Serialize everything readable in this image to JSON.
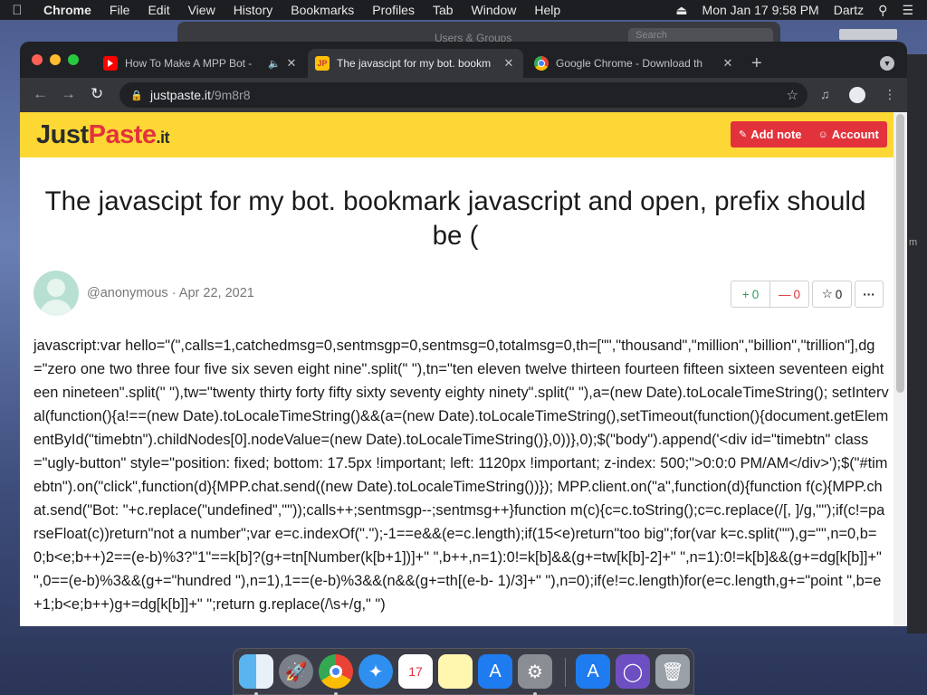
{
  "menubar": {
    "app": "Chrome",
    "menus": [
      "File",
      "Edit",
      "View",
      "History",
      "Bookmarks",
      "Profiles",
      "Tab",
      "Window",
      "Help"
    ],
    "clock": "Mon Jan 17  9:58 PM",
    "user": "Dartz"
  },
  "background_window": {
    "title": "Users & Groups",
    "search_placeholder": "Search",
    "edge_text": "m"
  },
  "tabs": [
    {
      "title": "How To Make A MPP Bot -",
      "favicon": "youtube-icon",
      "audio": true
    },
    {
      "title": "The javascipt for my bot. bookm",
      "favicon": "justpaste-icon",
      "active": true
    },
    {
      "title": "Google Chrome - Download th",
      "favicon": "chrome-icon"
    }
  ],
  "omnibox": {
    "host": "justpaste.it",
    "path": "/9m8r8"
  },
  "site": {
    "logo_part1": "Just",
    "logo_part2": "Paste",
    "logo_part3": ".it",
    "add_note": "Add note",
    "account": "Account",
    "brand_yellow": "#fdd835",
    "brand_red": "#e2333d"
  },
  "article": {
    "title": "The javascipt for my bot. bookmark javascript and open, prefix should be (",
    "author": "@anonymous",
    "separator": "·",
    "date": "Apr 22, 2021",
    "upvotes": "0",
    "downvotes": "0",
    "stars": "0",
    "more": "···",
    "body": "javascript:var hello=\"(\",calls=1,catchedmsg=0,sentmsgp=0,sentmsg=0,totalmsg=0,th=[\"\",\"thousand\",\"million\",\"billion\",\"trillion\"],dg=\"zero one two three four five six seven eight nine\".split(\" \"),tn=\"ten eleven twelve thirteen fourteen fifteen sixteen seventeen eighteen nineteen\".split(\" \"),tw=\"twenty thirty forty fifty sixty seventy eighty ninety\".split(\" \"),a=(new Date).toLocaleTimeString(); setInterval(function(){a!==(new Date).toLocaleTimeString()&&(a=(new Date).toLocaleTimeString(),setTimeout(function(){document.getElementById(\"timebtn\").childNodes[0].nodeValue=(new Date).toLocaleTimeString()},0))},0);$(\"body\").append('<div id=\"timebtn\" class=\"ugly-button\" style=\"position: fixed; bottom: 17.5px !important; left: 1120px !important; z-index: 500;\">0:0:0 PM/AM</div>');$(\"#timebtn\").on(\"click\",function(d){MPP.chat.send((new Date).toLocaleTimeString())}); MPP.client.on(\"a\",function(d){function f(c){MPP.chat.send(\"Bot: \"+c.replace(\"undefined\",\"\"));calls++;sentmsgp--;sentmsg++}function m(c){c=c.toString();c=c.replace(/[, ]/g,\"\");if(c!=parseFloat(c))return\"not a number\";var e=c.indexOf(\".\");-1==e&&(e=c.length);if(15<e)return\"too big\";for(var k=c.split(\"\"),g=\"\",n=0,b=0;b<e;b++)2==(e-b)%3?\"1\"==k[b]?(g+=tn[Number(k[b+1])]+\" \",b++,n=1):0!=k[b]&&(g+=tw[k[b]-2]+\" \",n=1):0!=k[b]&&(g+=dg[k[b]]+\" \",0==(e-b)%3&&(g+=\"hundred \"),n=1),1==(e-b)%3&&(n&&(g+=th[(e-b- 1)/3]+\" \"),n=0);if(e!=c.length)for(e=c.length,g+=\"point \",b=e+1;b<e;b++)g+=dg[k[b]]+\" \";return g.replace(/\\s+/g,\" \")"
  }
}
